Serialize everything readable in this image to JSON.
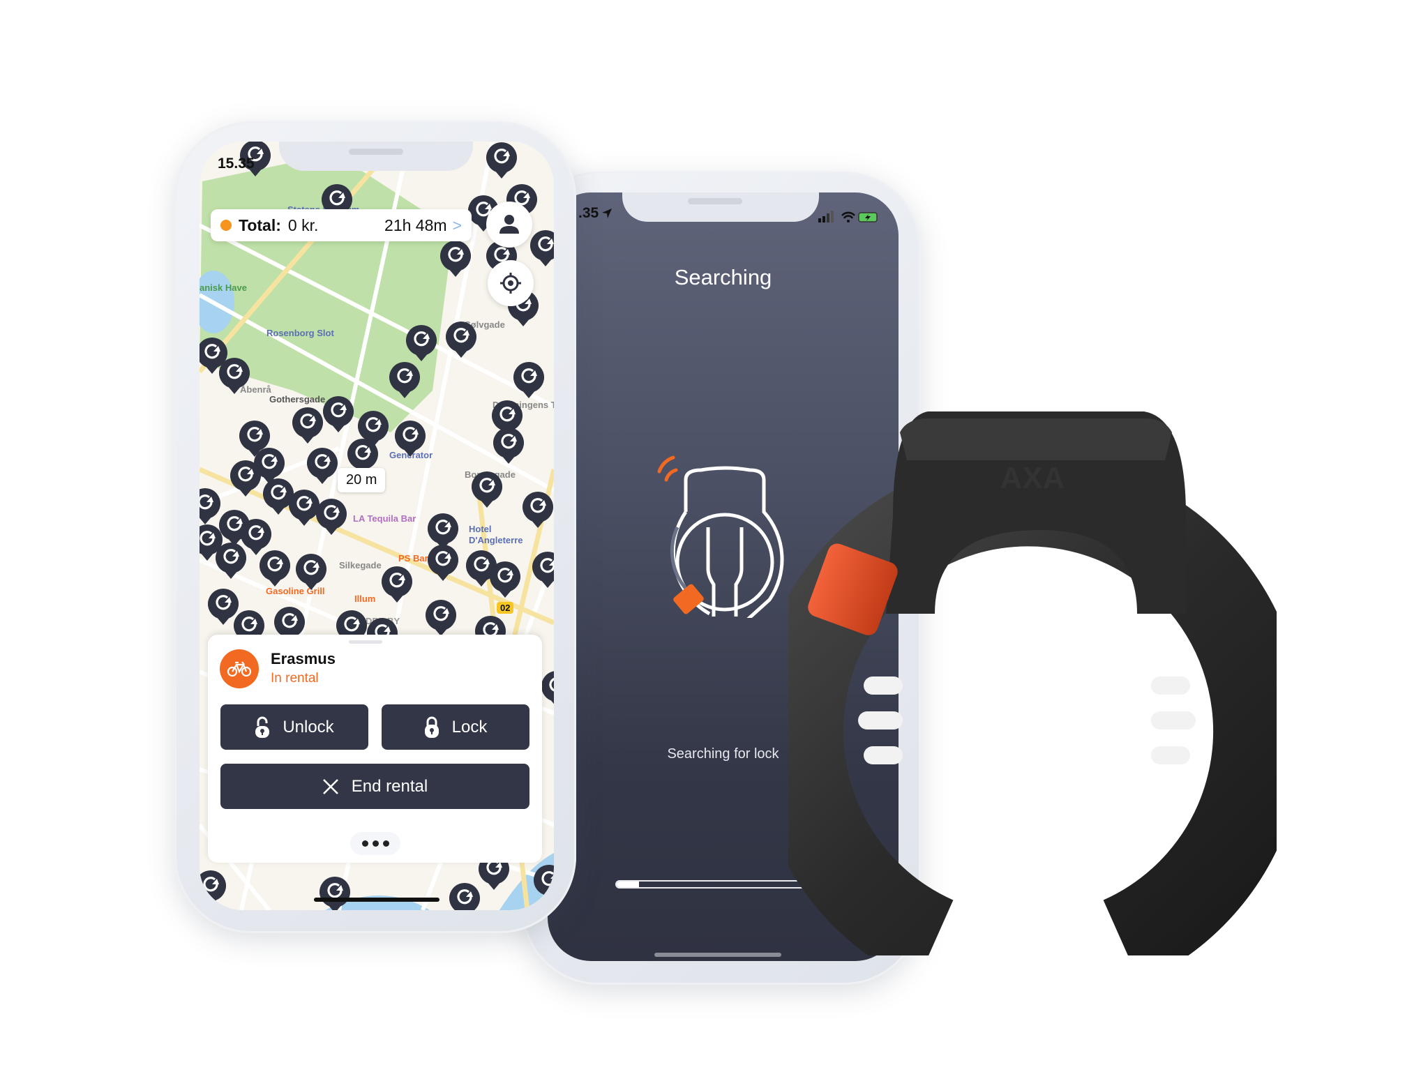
{
  "colors": {
    "accent_orange": "#f26a21",
    "total_dot": "#f7941d",
    "button_dark": "#333646",
    "pin_dark": "#2f3342",
    "searching_bg_top": "#5f647a",
    "searching_bg_bottom": "#2f3241"
  },
  "map_screen": {
    "status_time": "15.35",
    "total": {
      "label": "Total:",
      "amount": "0 kr.",
      "duration": "21h 48m",
      "chevron": ">"
    },
    "profile_icon": "user-icon",
    "locate_icon": "crosshair-icon",
    "distance_label": "20 m",
    "map_labels": [
      "Statens Museum",
      "anisk Have",
      "Rosenborg Slot",
      "Sølvgade",
      "Gothersgade",
      "Åbenrå",
      "Borgergade",
      "Dronningens Tvær",
      "Generator",
      "LA Tequila Bar",
      "Hotel",
      "D'Angleterre",
      "Silkegade",
      "Gasoline Grill",
      "Illum",
      "PS Bar",
      "INDRE BY",
      "02"
    ],
    "vehicle": {
      "name": "Erasmus",
      "status": "In rental",
      "icon": "bicycle-icon"
    },
    "buttons": {
      "unlock": "Unlock",
      "lock": "Lock",
      "end_rental": "End rental"
    },
    "more_icon": "ellipsis-icon"
  },
  "search_screen": {
    "status_time": ".35",
    "title": "Searching",
    "subtitle": "Searching for lock",
    "progress": 0.11
  },
  "product": {
    "brand_embossed": "AXA"
  }
}
